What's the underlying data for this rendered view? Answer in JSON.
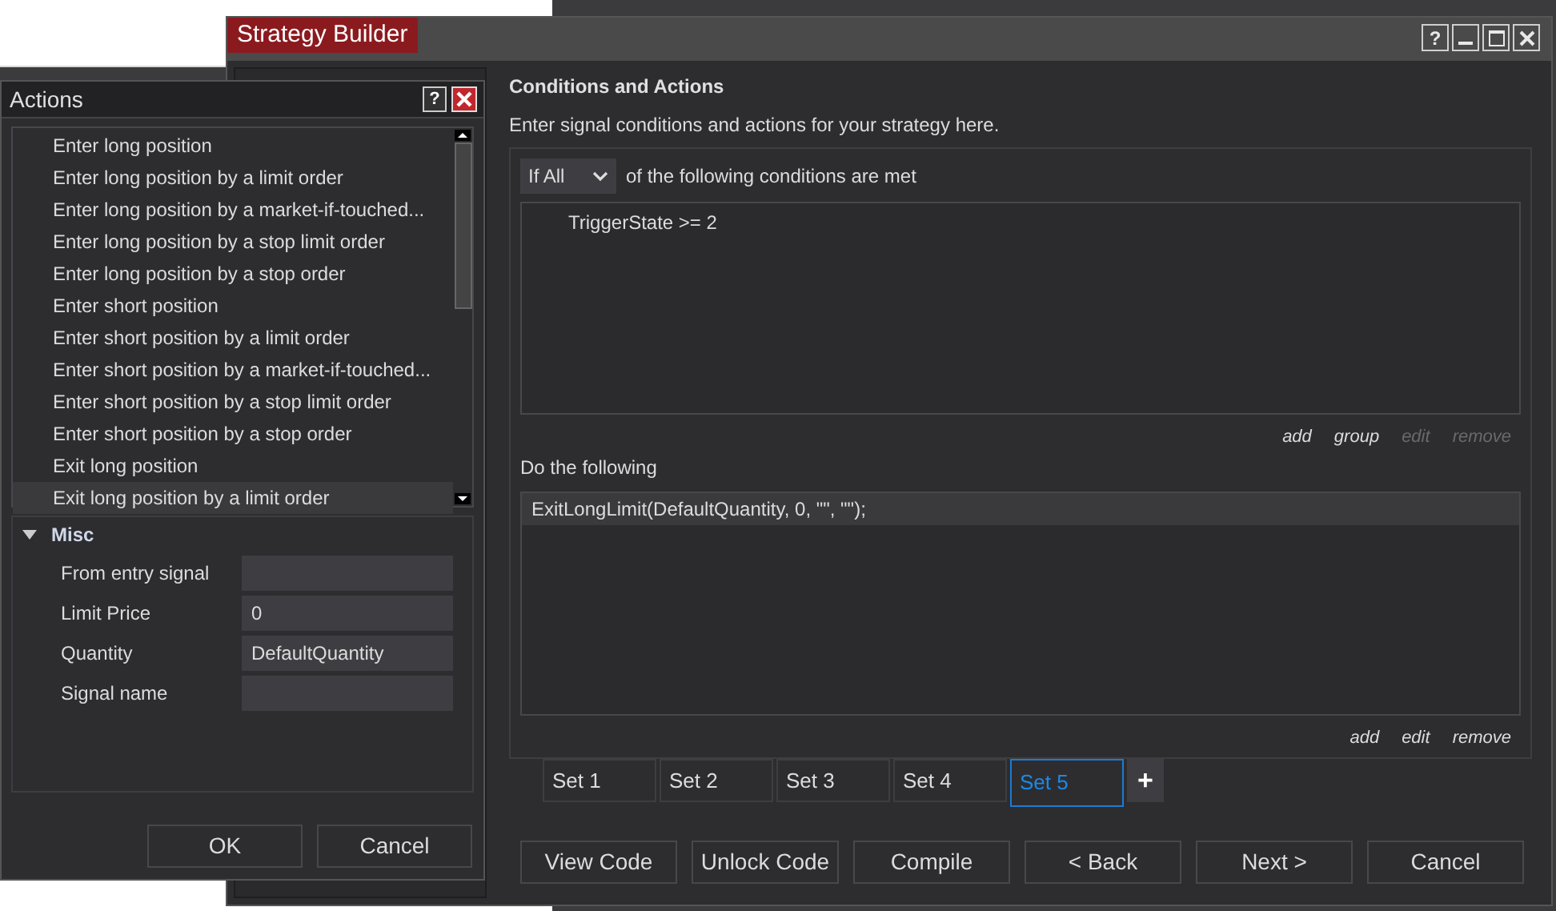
{
  "strategy_builder": {
    "title": "Strategy Builder",
    "window_buttons": [
      "?"
    ],
    "heading": "Conditions and Actions",
    "subtitle": "Enter signal conditions and actions for your strategy here.",
    "conditions": {
      "mode": "If All",
      "mode_suffix": "of the following conditions are met",
      "items": [
        "TriggerState >= 2"
      ],
      "links": [
        {
          "label": "add",
          "disabled": false
        },
        {
          "label": "group",
          "disabled": false
        },
        {
          "label": "edit",
          "disabled": true
        },
        {
          "label": "remove",
          "disabled": true
        }
      ]
    },
    "actions": {
      "label": "Do the following",
      "items": [
        {
          "text": "ExitLongLimit(DefaultQuantity, 0, \"\", \"\");",
          "selected": true
        }
      ],
      "links": [
        {
          "label": "add",
          "disabled": false
        },
        {
          "label": "edit",
          "disabled": false
        },
        {
          "label": "remove",
          "disabled": false
        }
      ]
    },
    "sets": [
      {
        "label": "Set 1",
        "selected": false
      },
      {
        "label": "Set 2",
        "selected": false
      },
      {
        "label": "Set 3",
        "selected": false
      },
      {
        "label": "Set 4",
        "selected": false
      },
      {
        "label": "Set 5",
        "selected": true
      }
    ],
    "add_set": "+",
    "buttons": [
      "View Code",
      "Unlock Code",
      "Compile",
      "< Back",
      "Next >",
      "Cancel"
    ]
  },
  "actions_dialog": {
    "title": "Actions",
    "help": "?",
    "items": [
      {
        "label": "Enter long position",
        "selected": false
      },
      {
        "label": "Enter long position by a limit order",
        "selected": false
      },
      {
        "label": "Enter long position by a market-if-touched...",
        "selected": false
      },
      {
        "label": "Enter long position by a stop limit order",
        "selected": false
      },
      {
        "label": "Enter long position by a stop order",
        "selected": false
      },
      {
        "label": "Enter short position",
        "selected": false
      },
      {
        "label": "Enter short position by a limit order",
        "selected": false
      },
      {
        "label": "Enter short position by a market-if-touched...",
        "selected": false
      },
      {
        "label": "Enter short position by a stop limit order",
        "selected": false
      },
      {
        "label": "Enter short position by a stop order",
        "selected": false
      },
      {
        "label": "Exit long position",
        "selected": false
      },
      {
        "label": "Exit long position by a limit order",
        "selected": true
      }
    ],
    "section": {
      "title": "Misc",
      "expanded": true,
      "properties": [
        {
          "name": "From entry signal"
        },
        {
          "name": "Limit Price",
          "value": "0"
        },
        {
          "name": "Quantity",
          "value": "DefaultQuantity"
        },
        {
          "name": "Signal name"
        }
      ]
    },
    "buttons": [
      "OK",
      "Cancel"
    ]
  }
}
